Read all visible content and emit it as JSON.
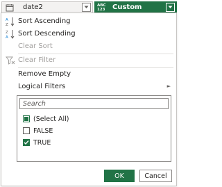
{
  "header": {
    "left_column": {
      "name": "date2"
    },
    "right_column": {
      "name": "Custom",
      "type_badge_top": "ABC",
      "type_badge_bottom": "123"
    }
  },
  "menu": {
    "sort_ascending": "Sort Ascending",
    "sort_descending": "Sort Descending",
    "clear_sort": "Clear Sort",
    "clear_filter": "Clear Filter",
    "remove_empty": "Remove Empty",
    "logical_filters": "Logical Filters"
  },
  "filter": {
    "search_placeholder": "Search",
    "items": [
      {
        "label": "(Select All)",
        "state": "partial"
      },
      {
        "label": "FALSE",
        "state": "unchecked"
      },
      {
        "label": "TRUE",
        "state": "checked"
      }
    ]
  },
  "buttons": {
    "ok": "OK",
    "cancel": "Cancel"
  },
  "colors": {
    "accent": "#217346",
    "disabled": "#a19f9d",
    "border": "#8a8886"
  }
}
